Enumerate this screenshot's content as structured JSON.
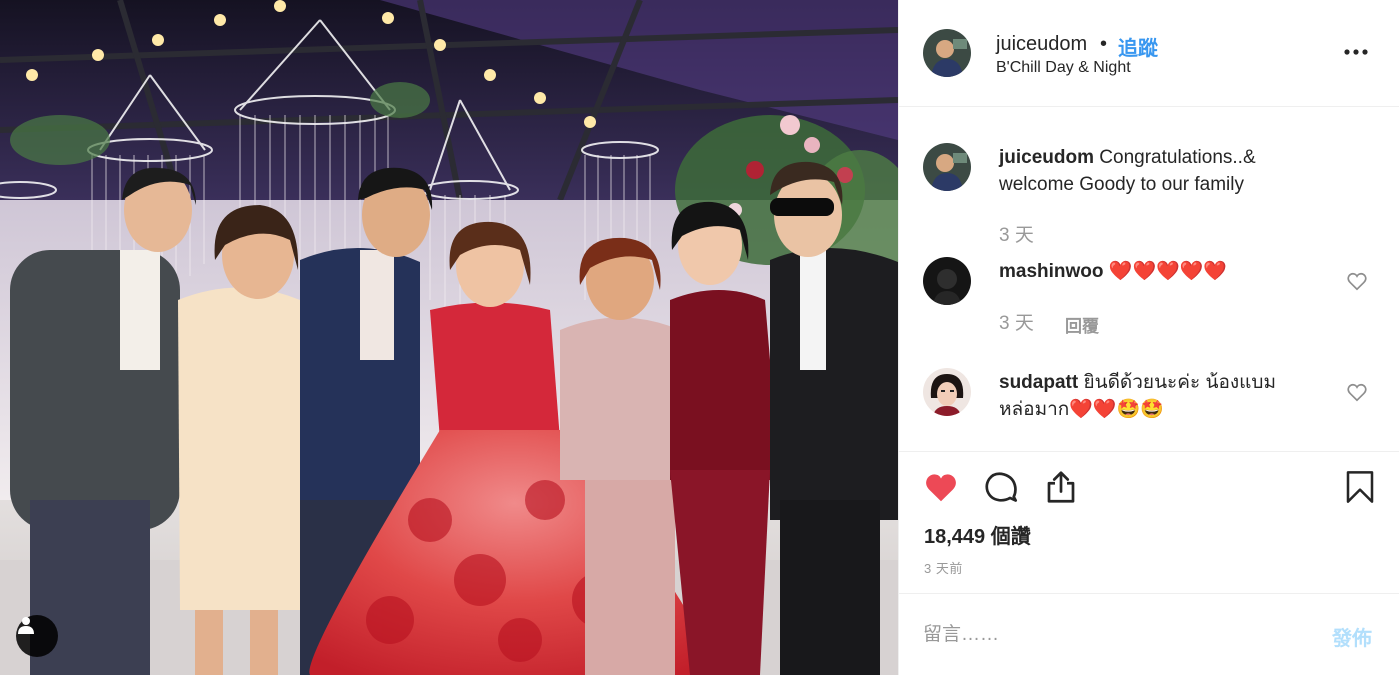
{
  "header": {
    "username": "juiceudom",
    "dot": "•",
    "follow_label": "追蹤",
    "location": "B'Chill Day & Night"
  },
  "comments": [
    {
      "username": "juiceudom",
      "text": "Congratulations..&",
      "text_line2": "welcome Goody to our family",
      "time": "3 天"
    },
    {
      "username": "mashinwoo",
      "text": "❤️❤️❤️❤️❤️",
      "time": "3 天",
      "reply_label": "回覆"
    },
    {
      "username": "sudapatt",
      "text": "ยินดีด้วยนะค่ะ น้องแบม",
      "text_line2": "หล่อมาก❤️❤️🤩🤩"
    }
  ],
  "actions": {
    "likes": "18,449 個讚",
    "time_ago": "3 天前"
  },
  "comment_box": {
    "placeholder": "留言……",
    "post_label": "發佈"
  },
  "colors": {
    "accent": "#3897f0",
    "like_red": "#ed4956",
    "post_disabled": "#b2dffc"
  },
  "icons": [
    "user-tag-icon",
    "more-options-icon",
    "heart-outline-icon",
    "heart-filled-icon",
    "comment-icon",
    "share-icon",
    "bookmark-icon"
  ]
}
